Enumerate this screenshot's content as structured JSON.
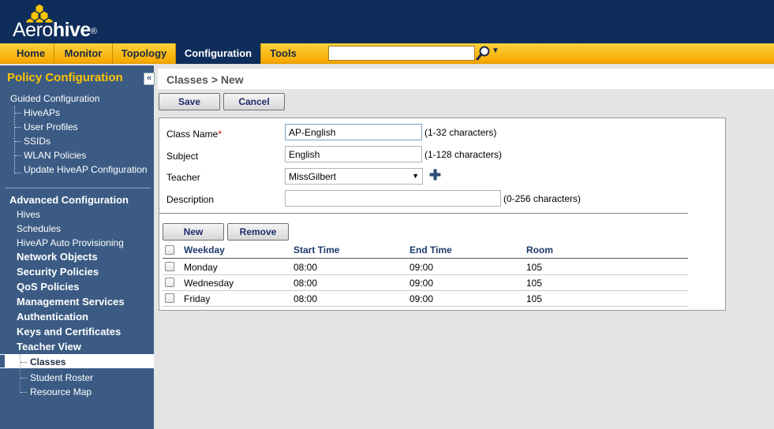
{
  "brand": {
    "name_light": "Aero",
    "name_bold": "hive",
    "reg_mark": "®"
  },
  "nav": {
    "tabs": [
      {
        "label": "Home"
      },
      {
        "label": "Monitor"
      },
      {
        "label": "Topology"
      },
      {
        "label": "Configuration",
        "active": true
      },
      {
        "label": "Tools"
      }
    ],
    "search_value": ""
  },
  "sidebar": {
    "title": "Policy Configuration",
    "collapse_label": "«",
    "guided": {
      "label": "Guided Configuration",
      "items": [
        "HiveAPs",
        "User Profiles",
        "SSIDs",
        "WLAN Policies",
        "Update HiveAP Configuration"
      ]
    },
    "advanced": {
      "label": "Advanced Configuration",
      "plain_items": [
        "Hives",
        "Schedules",
        "HiveAP Auto Provisioning"
      ],
      "bold_items": [
        "Network Objects",
        "Security Policies",
        "QoS Policies",
        "Management Services",
        "Authentication",
        "Keys and Certificates",
        "Teacher View"
      ],
      "teacher_view_items": [
        "Classes",
        "Student Roster",
        "Resource Map"
      ],
      "active_item": "Classes"
    }
  },
  "page": {
    "breadcrumb": "Classes > New",
    "save_label": "Save",
    "cancel_label": "Cancel"
  },
  "form": {
    "class_name": {
      "label": "Class Name",
      "required_mark": "*",
      "value": "AP-English",
      "hint": "(1-32 characters)"
    },
    "subject": {
      "label": "Subject",
      "value": "English",
      "hint": "(1-128 characters)"
    },
    "teacher": {
      "label": "Teacher",
      "value": "MissGilbert",
      "add_label": "✚"
    },
    "description": {
      "label": "Description",
      "value": "",
      "hint": "(0-256 characters)"
    }
  },
  "schedule": {
    "new_label": "New",
    "remove_label": "Remove",
    "columns": [
      "Weekday",
      "Start Time",
      "End Time",
      "Room"
    ],
    "rows": [
      {
        "weekday": "Monday",
        "start": "08:00",
        "end": "09:00",
        "room": "105"
      },
      {
        "weekday": "Wednesday",
        "start": "08:00",
        "end": "09:00",
        "room": "105"
      },
      {
        "weekday": "Friday",
        "start": "08:00",
        "end": "09:00",
        "room": "105"
      }
    ]
  },
  "colors": {
    "header": "#0f2d5a",
    "nav": "#f6a800",
    "sidebar": "#3b5b84",
    "sidebar_title": "#ffc400"
  }
}
